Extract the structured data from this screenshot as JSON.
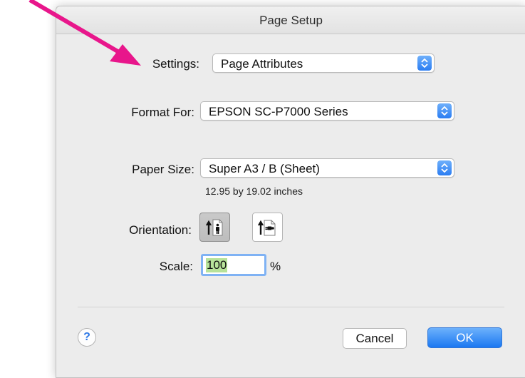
{
  "window": {
    "title": "Page Setup"
  },
  "settings": {
    "label": "Settings:",
    "value": "Page Attributes"
  },
  "format_for": {
    "label": "Format For:",
    "value": "EPSON SC-P7000 Series"
  },
  "paper_size": {
    "label": "Paper Size:",
    "value": "Super A3 / B (Sheet)",
    "dimensions": "12.95 by 19.02 inches"
  },
  "orientation": {
    "label": "Orientation:",
    "selected": "portrait"
  },
  "scale": {
    "label": "Scale:",
    "value": "100",
    "unit": "%"
  },
  "buttons": {
    "help": "?",
    "cancel": "Cancel",
    "ok": "OK"
  },
  "colors": {
    "accent": "#2b7df2",
    "annotation_arrow": "#e8168b",
    "selection_highlight": "#b7e29a"
  },
  "icons": {
    "orientation_portrait": "portrait-orientation-icon",
    "orientation_landscape": "landscape-orientation-icon",
    "popup_stepper": "chevron-up-down-icon",
    "annotation": "pink-pointer-arrow"
  }
}
